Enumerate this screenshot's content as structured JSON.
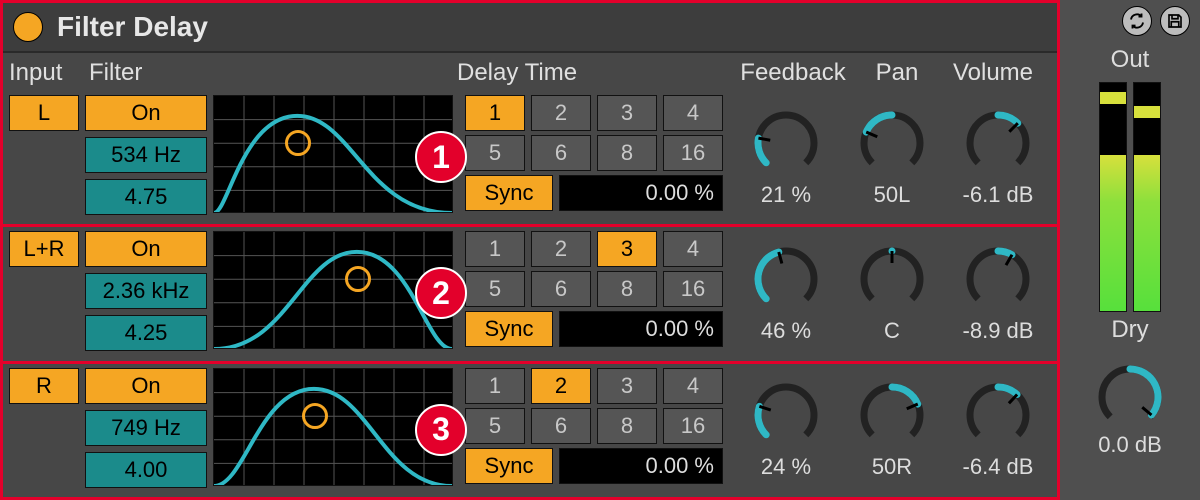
{
  "title": "Filter Delay",
  "headers": {
    "input": "Input",
    "filter": "Filter",
    "delay": "Delay Time",
    "feedback": "Feedback",
    "pan": "Pan",
    "volume": "Volume"
  },
  "shared": {
    "sync_label": "Sync"
  },
  "rows": [
    {
      "badge": "1",
      "input": "L",
      "filter_on": "On",
      "freq": "534 Hz",
      "q": "4.75",
      "beats_row1": [
        "1",
        "2",
        "3",
        "4"
      ],
      "beats_row2": [
        "5",
        "6",
        "8",
        "16"
      ],
      "selected_beat": 0,
      "offset": "0.00 %",
      "feedback": "21 %",
      "feedback_deg": 55,
      "pan": "50L",
      "pan_deg": -67,
      "volume": "-6.1 dB",
      "vol_deg": 45,
      "curve_center": 0.35
    },
    {
      "badge": "2",
      "input": "L+R",
      "filter_on": "On",
      "freq": "2.36 kHz",
      "q": "4.25",
      "beats_row1": [
        "1",
        "2",
        "3",
        "4"
      ],
      "beats_row2": [
        "5",
        "6",
        "8",
        "16"
      ],
      "selected_beat": 2,
      "offset": "0.00 %",
      "feedback": "46 %",
      "feedback_deg": 120,
      "pan": "C",
      "pan_deg": 0,
      "volume": "-8.9 dB",
      "vol_deg": 30,
      "curve_center": 0.6
    },
    {
      "badge": "3",
      "input": "R",
      "filter_on": "On",
      "freq": "749 Hz",
      "q": "4.00",
      "beats_row1": [
        "1",
        "2",
        "3",
        "4"
      ],
      "beats_row2": [
        "5",
        "6",
        "8",
        "16"
      ],
      "selected_beat": 1,
      "offset": "0.00 %",
      "feedback": "24 %",
      "feedback_deg": 63,
      "pan": "50R",
      "pan_deg": 67,
      "volume": "-6.4 dB",
      "vol_deg": 43,
      "curve_center": 0.42
    }
  ],
  "side": {
    "out_label": "Out",
    "dry_label": "Dry",
    "dry_value": "0.0 dB",
    "meter_left_fill": 0.68,
    "meter_right_fill": 0.68,
    "meter_left_peak": 0.9,
    "meter_right_peak": 0.84
  }
}
